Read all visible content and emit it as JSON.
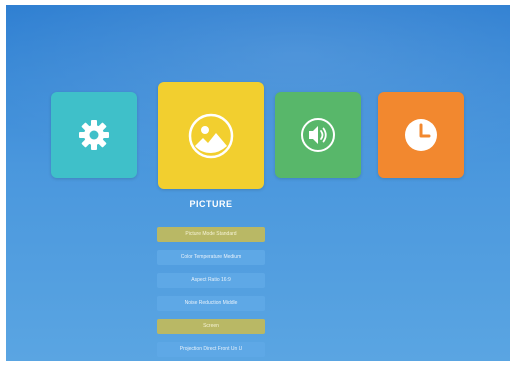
{
  "colors": {
    "background_top": "#2d7ed1",
    "background_bottom": "#5aa5e2",
    "settings_tile": "#3fc0c9",
    "picture_tile": "#f2cf2f",
    "sound_tile": "#58b76a",
    "timer_tile": "#f2882f",
    "menu_item": "#5ea8e6",
    "menu_item_active": "#b9b865"
  },
  "tiles": [
    {
      "id": "settings",
      "icon": "gear-icon",
      "selected": false
    },
    {
      "id": "picture",
      "icon": "picture-icon",
      "selected": true
    },
    {
      "id": "sound",
      "icon": "speaker-icon",
      "selected": false
    },
    {
      "id": "timer",
      "icon": "clock-icon",
      "selected": false
    }
  ],
  "selected_label": "PICTURE",
  "submenu": {
    "items": [
      {
        "label": "Picture Mode Standard",
        "active": true
      },
      {
        "label": "Color Temperature Medium",
        "active": false
      },
      {
        "label": "Aspect Ratio 16:9",
        "active": false
      },
      {
        "label": "Noise Reduction Middle",
        "active": false
      },
      {
        "label": "Screen",
        "active": true
      },
      {
        "label": "Projection Direct Front Un U",
        "active": false
      }
    ]
  }
}
